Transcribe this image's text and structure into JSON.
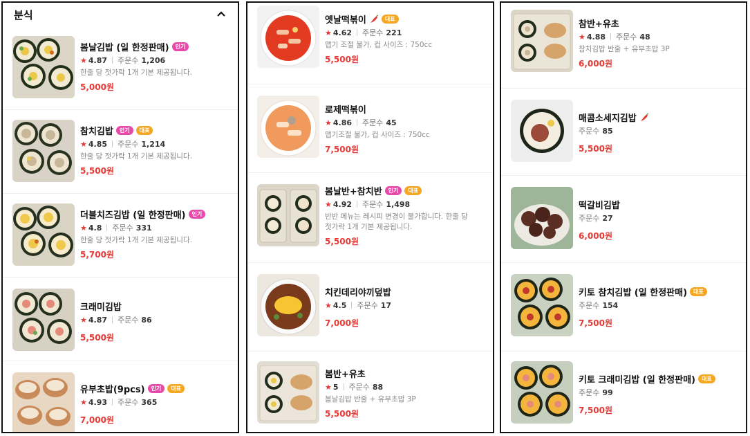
{
  "panel1": {
    "category": "분식",
    "items": [
      {
        "name": "봄날김밥 (일 한정판매)",
        "badges": [
          "인기"
        ],
        "rating": "4.87",
        "orders_label": "주문수",
        "orders": "1,206",
        "desc": "한줄 당 젓가락 1개 기본 제공됩니다.",
        "price": "5,000원"
      },
      {
        "name": "참치김밥",
        "badges": [
          "인기",
          "대표"
        ],
        "rating": "4.85",
        "orders_label": "주문수",
        "orders": "1,214",
        "desc": "한줄 당 젓가락 1개 기본 제공됩니다.",
        "price": "5,500원"
      },
      {
        "name": "더블치즈김밥 (일 한정판매)",
        "badges": [
          "인기"
        ],
        "rating": "4.8",
        "orders_label": "주문수",
        "orders": "331",
        "desc": "한줄 당 젓가락 1개 기본 제공됩니다.",
        "price": "5,700원"
      },
      {
        "name": "크래미김밥",
        "badges": [],
        "rating": "4.87",
        "orders_label": "주문수",
        "orders": "86",
        "desc": "",
        "price": "5,500원"
      },
      {
        "name": "유부초밥(9pcs)",
        "badges": [
          "인기",
          "대표"
        ],
        "rating": "4.93",
        "orders_label": "주문수",
        "orders": "365",
        "desc": "",
        "price": "7,000원"
      }
    ]
  },
  "panel2": {
    "items": [
      {
        "name": "옛날떡볶이",
        "spicy": true,
        "badges": [
          "대표"
        ],
        "rating": "4.62",
        "orders_label": "주문수",
        "orders": "221",
        "desc": "맵기 조절 불가, 컵 사이즈 : 750cc",
        "price": "5,500원"
      },
      {
        "name": "로제떡볶이",
        "badges": [],
        "rating": "4.86",
        "orders_label": "주문수",
        "orders": "45",
        "desc": "맵기조절 불가, 컵 사이즈 : 750cc",
        "price": "7,500원"
      },
      {
        "name": "봄날반+참치반",
        "badges": [
          "인기",
          "대표"
        ],
        "rating": "4.92",
        "orders_label": "주문수",
        "orders": "1,498",
        "desc1": "반반 메뉴는 레시피 변경이 불가합니다. 한줄 당",
        "desc2": "젓가락 1개 기본 제공됩니다.",
        "price": "5,500원"
      },
      {
        "name": "치킨데리야끼덮밥",
        "badges": [],
        "rating": "4.5",
        "orders_label": "주문수",
        "orders": "17",
        "desc": "",
        "price": "7,000원"
      },
      {
        "name": "봄반+유초",
        "badges": [],
        "rating": "5",
        "orders_label": "주문수",
        "orders": "88",
        "desc": "봄날김밥 반줄 + 유부초밥 3P",
        "price": "5,500원"
      }
    ]
  },
  "panel3": {
    "items": [
      {
        "name": "참반+유초",
        "badges": [],
        "rating": "4.88",
        "orders_label": "주문수",
        "orders": "48",
        "desc": "참치김밥 반줄 + 유부초밥 3P",
        "price": "6,000원"
      },
      {
        "name": "매콤소세지김밥",
        "spicy": true,
        "badges": [],
        "orders_label": "주문수",
        "orders": "85",
        "desc": "",
        "price": "5,500원"
      },
      {
        "name": "떡갈비김밥",
        "badges": [],
        "orders_label": "주문수",
        "orders": "27",
        "desc": "",
        "price": "6,000원"
      },
      {
        "name": "키토 참치김밥 (일 한정판매)",
        "badges": [
          "대표"
        ],
        "orders_label": "주문수",
        "orders": "154",
        "desc": "",
        "price": "7,500원"
      },
      {
        "name": "키토 크래미김밥 (일 한정판매)",
        "badges": [
          "대표"
        ],
        "orders_label": "주문수",
        "orders": "99",
        "desc": "",
        "price": "7,500원"
      }
    ]
  },
  "colors": {
    "price": "#e53935",
    "badge_popular": "#e84aa9",
    "badge_rep": "#f5a623",
    "star": "#e53935"
  },
  "icons": {
    "collapse": "chevron-up-icon",
    "rating": "star-icon",
    "spicy": "chili-pepper-icon"
  }
}
